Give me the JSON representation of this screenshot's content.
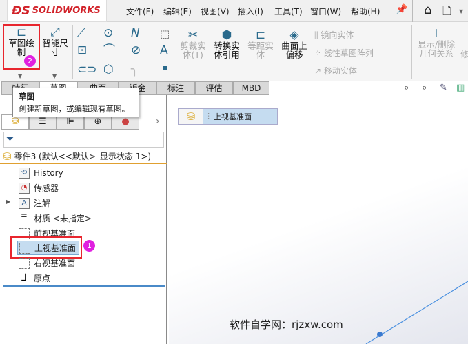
{
  "app": {
    "logo": "SOLIDWORKS"
  },
  "menu": [
    "文件(F)",
    "编辑(E)",
    "视图(V)",
    "插入(I)",
    "工具(T)",
    "窗口(W)",
    "帮助(H)"
  ],
  "ribbon": {
    "sketch": "草图绘制",
    "smart_dim": "智能尺寸",
    "trim": "剪裁实体(T)",
    "convert": "转换实体引用",
    "offset": "等距实体",
    "surface_offset": "曲面上偏移",
    "mirror": "镜向实体",
    "linear_pattern": "线性草图阵列",
    "move": "移动实体",
    "relations": "显示/删除几何关系",
    "repair": "修"
  },
  "tabs": [
    "特征",
    "草图",
    "曲面",
    "钣金",
    "标注",
    "评估",
    "MBD"
  ],
  "tooltip": {
    "title": "草图",
    "body": "创建新草图，或编辑现有草图。"
  },
  "tree": {
    "root": "零件3  (默认<<默认>_显示状态 1>)",
    "items": [
      "History",
      "传感器",
      "注解",
      "材质 <未指定>",
      "前视基准面",
      "上视基准面",
      "右视基准面",
      "原点"
    ]
  },
  "breadcrumb": "上视基准面",
  "badges": [
    "1",
    "2"
  ],
  "watermark": "软件自学网：rjzxw.com",
  "colors": {
    "accent": "#e8262e",
    "badge": "#e020e0",
    "selected": "#c5dcf0"
  }
}
